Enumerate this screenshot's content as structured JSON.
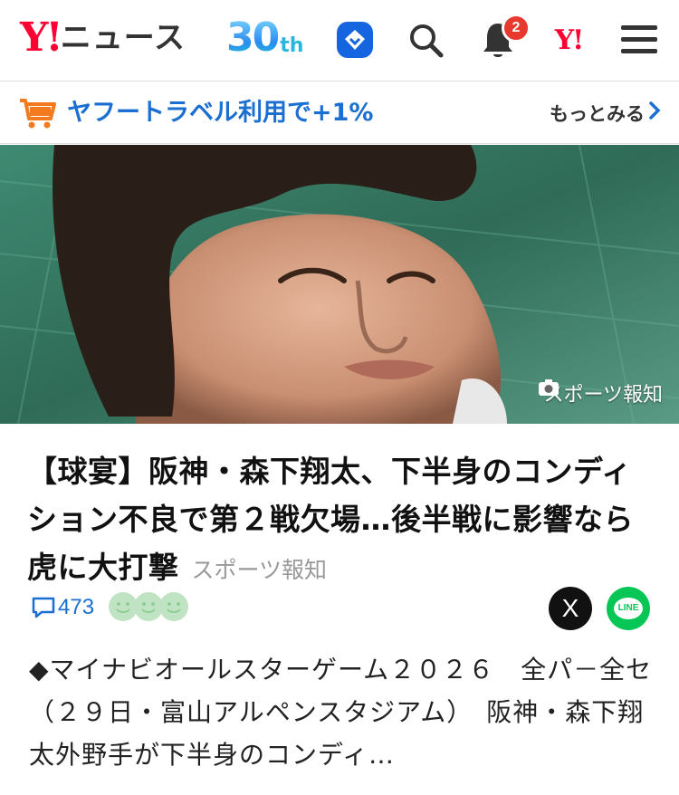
{
  "header": {
    "logo_mark": "Y!",
    "logo_text": "ニュース",
    "anniversary_number": "30",
    "anniversary_suffix": "th",
    "notification_count": "2",
    "yahoo_mark": "Y!",
    "icons": [
      "premium-icon",
      "search-icon",
      "bell-icon",
      "yahoo-logo-icon",
      "menu-icon"
    ]
  },
  "promo": {
    "text": "ヤフートラベル利用で+1%",
    "more_label": "もっとみる",
    "icons": [
      "cart-icon",
      "chevron-right-icon"
    ]
  },
  "hero": {
    "credit": "スポーツ報知"
  },
  "article": {
    "title": "【球宴】阪神・森下翔太、下半身のコンディション不良で第２戦欠場…後半戦に影響なら虎に大打撃",
    "source": "スポーツ報知",
    "comment_count": "473",
    "body": "◆マイナビオールスターゲーム２０２６　全パ－全セ（２９日・富山アルペンスタジアム）　阪神・森下翔太外野手が下半身のコンディ…",
    "share": {
      "x_label": "X",
      "line_label": "LINE"
    }
  },
  "colors": {
    "brand_red": "#ff0033",
    "link_blue": "#1a6fd0",
    "line_green": "#06c755",
    "badge_red": "#e8392f"
  }
}
